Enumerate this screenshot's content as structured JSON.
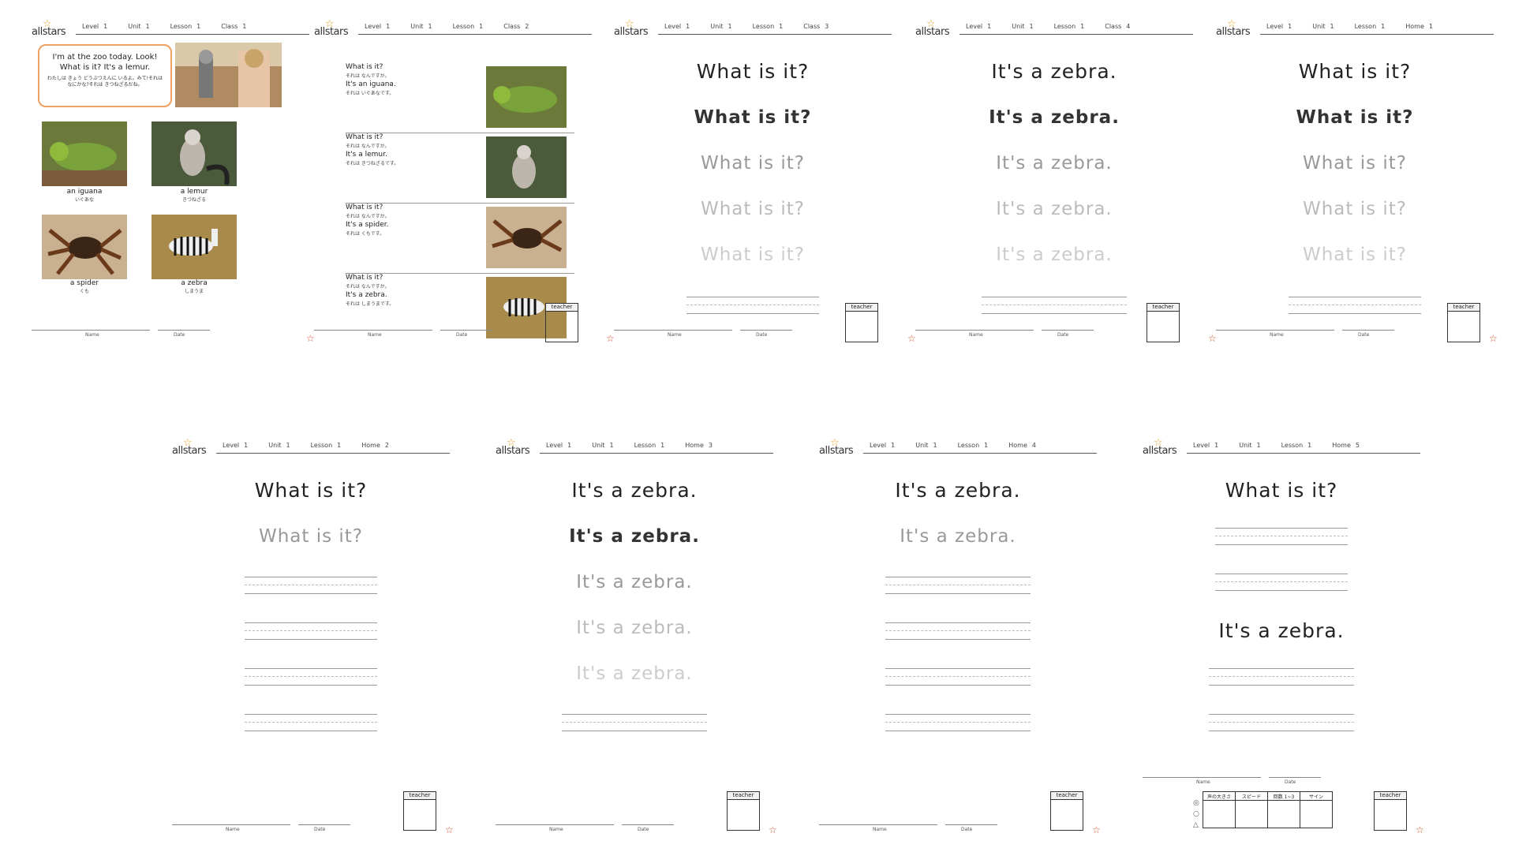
{
  "brand": "allstars",
  "footer": {
    "name_label": "Name",
    "date_label": "Date",
    "teacher_label": "teacher"
  },
  "sheets": [
    {
      "header": {
        "f1": "Level",
        "v1": "1",
        "f2": "Unit",
        "v2": "1",
        "f3": "Lesson",
        "v3": "1",
        "f4": "Class",
        "v4": "1"
      }
    },
    {
      "header": {
        "f1": "Level",
        "v1": "1",
        "f2": "Unit",
        "v2": "1",
        "f3": "Lesson",
        "v3": "1",
        "f4": "Class",
        "v4": "2"
      }
    },
    {
      "header": {
        "f1": "Level",
        "v1": "1",
        "f2": "Unit",
        "v2": "1",
        "f3": "Lesson",
        "v3": "1",
        "f4": "Class",
        "v4": "3"
      }
    },
    {
      "header": {
        "f1": "Level",
        "v1": "1",
        "f2": "Unit",
        "v2": "1",
        "f3": "Lesson",
        "v3": "1",
        "f4": "Class",
        "v4": "4"
      }
    },
    {
      "header": {
        "f1": "Level",
        "v1": "1",
        "f2": "Unit",
        "v2": "1",
        "f3": "Lesson",
        "v3": "1",
        "f4": "Home",
        "v4": "1"
      }
    },
    {
      "header": {
        "f1": "Level",
        "v1": "1",
        "f2": "Unit",
        "v2": "1",
        "f3": "Lesson",
        "v3": "1",
        "f4": "Home",
        "v4": "2"
      }
    },
    {
      "header": {
        "f1": "Level",
        "v1": "1",
        "f2": "Unit",
        "v2": "1",
        "f3": "Lesson",
        "v3": "1",
        "f4": "Home",
        "v4": "3"
      }
    },
    {
      "header": {
        "f1": "Level",
        "v1": "1",
        "f2": "Unit",
        "v2": "1",
        "f3": "Lesson",
        "v3": "1",
        "f4": "Home",
        "v4": "4"
      }
    },
    {
      "header": {
        "f1": "Level",
        "v1": "1",
        "f2": "Unit",
        "v2": "1",
        "f3": "Lesson",
        "v3": "1",
        "f4": "Home",
        "v4": "5"
      }
    }
  ],
  "intro": {
    "speech": "I'm at the zoo today. Look! What is it? It's a lemur.",
    "speech_jp": "わたしは きょう どうぶつえんに いるよ。みて!それは なにかな?それは きつねざるだね。",
    "animals": [
      {
        "en": "an iguana",
        "jp": "いぐあな"
      },
      {
        "en": "a lemur",
        "jp": "きつねざる"
      },
      {
        "en": "a spider",
        "jp": "くも"
      },
      {
        "en": "a zebra",
        "jp": "しまうま"
      }
    ]
  },
  "qa": [
    {
      "q": "What is it?",
      "q_jp": "それは なんですか。",
      "a": "It's an iguana.",
      "a_jp": "それは いぐあなです。"
    },
    {
      "q": "What is it?",
      "q_jp": "それは なんですか。",
      "a": "It's a lemur.",
      "a_jp": "それは きつねざるです。"
    },
    {
      "q": "What is it?",
      "q_jp": "それは なんですか。",
      "a": "It's a spider.",
      "a_jp": "それは くもです。"
    },
    {
      "q": "What is it?",
      "q_jp": "それは なんですか。",
      "a": "It's a zebra.",
      "a_jp": "それは しまうまです。"
    }
  ],
  "phrases": {
    "what": "What is it?",
    "zebra": "It's a zebra."
  },
  "eval": {
    "headers": [
      "声の大きさ",
      "スピード",
      "回数 1~3",
      "サイン"
    ],
    "marks": [
      "◎",
      "○",
      "△"
    ]
  },
  "colors": {
    "accent": "#f0a060",
    "star": "#d0552a"
  }
}
